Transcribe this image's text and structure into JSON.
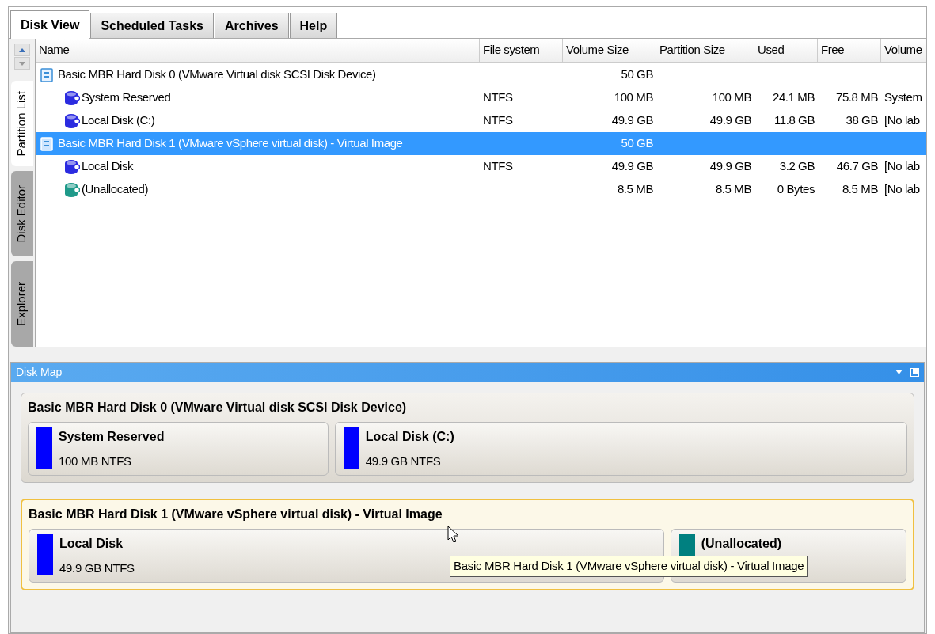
{
  "tabs": [
    {
      "label": "Disk View",
      "selected": true
    },
    {
      "label": "Scheduled Tasks",
      "selected": false
    },
    {
      "label": "Archives",
      "selected": false
    },
    {
      "label": "Help",
      "selected": false
    }
  ],
  "side_tabs": [
    {
      "label": "Partition List",
      "selected": true
    },
    {
      "label": "Disk Editor",
      "selected": false
    },
    {
      "label": "Explorer",
      "selected": false
    }
  ],
  "table": {
    "columns": [
      "Name",
      "File system",
      "Volume Size",
      "Partition Size",
      "Used",
      "Free",
      "Volume"
    ],
    "rows": [
      {
        "cells": [
          "Basic MBR Hard Disk 0 (VMware Virtual disk SCSI Disk Device)",
          "",
          "50 GB",
          "",
          "",
          "",
          ""
        ],
        "selected": false,
        "children": [
          {
            "cells": [
              "System Reserved",
              "NTFS",
              "100 MB",
              "100 MB",
              "24.1 MB",
              "75.8 MB",
              "System"
            ],
            "color": "#2b2be0"
          },
          {
            "cells": [
              "Local Disk (C:)",
              "NTFS",
              "49.9 GB",
              "49.9 GB",
              "11.8 GB",
              "38 GB",
              "[No lab"
            ],
            "color": "#2b2be0"
          }
        ]
      },
      {
        "cells": [
          "Basic MBR Hard Disk 1 (VMware vSphere virtual disk) - Virtual Image",
          "",
          "50 GB",
          "",
          "",
          "",
          ""
        ],
        "selected": true,
        "children": [
          {
            "cells": [
              "Local Disk",
              "NTFS",
              "49.9 GB",
              "49.9 GB",
              "3.2 GB",
              "46.7 GB",
              "[No lab"
            ],
            "color": "#2b2be0"
          },
          {
            "cells": [
              "(Unallocated)",
              "",
              "8.5 MB",
              "8.5 MB",
              "0 Bytes",
              "8.5 MB",
              "[No lab"
            ],
            "color": "#1f9a8a"
          }
        ]
      }
    ]
  },
  "disk_map": {
    "title": "Disk Map",
    "disks": [
      {
        "title": "Basic MBR Hard Disk 0 (VMware Virtual disk SCSI Disk Device)",
        "highlighted": false,
        "partitions": [
          {
            "name": "System Reserved",
            "detail": "100 MB NTFS",
            "color": "#0000ff"
          },
          {
            "name": "Local Disk (C:)",
            "detail": "49.9 GB NTFS",
            "color": "#0000ff"
          }
        ]
      },
      {
        "title": "Basic MBR Hard Disk 1 (VMware vSphere virtual disk) - Virtual Image",
        "highlighted": true,
        "partitions": [
          {
            "name": "Local Disk",
            "detail": "49.9 GB NTFS",
            "color": "#0000ff"
          },
          {
            "name": "(Unallocated)",
            "color": "#008080"
          }
        ]
      }
    ]
  },
  "tooltip": {
    "text": "Basic MBR Hard Disk 1 (VMware vSphere virtual disk) - Virtual Image"
  }
}
